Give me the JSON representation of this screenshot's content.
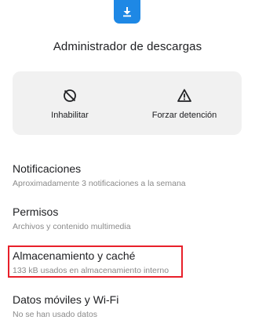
{
  "app": {
    "title": "Administrador de descargas",
    "icon": "download-icon",
    "icon_color": "#1e88e5"
  },
  "actions": [
    {
      "label": "Inhabilitar",
      "icon": "disable-icon"
    },
    {
      "label": "Forzar detención",
      "icon": "warning-icon"
    }
  ],
  "settings": [
    {
      "title": "Notificaciones",
      "subtitle": "Aproximadamente 3 notificaciones a la semana"
    },
    {
      "title": "Permisos",
      "subtitle": "Archivos y contenido multimedia"
    },
    {
      "title": "Almacenamiento y caché",
      "subtitle": "133 kB usados en almacenamiento interno",
      "highlighted": true
    },
    {
      "title": "Datos móviles y Wi-Fi",
      "subtitle": "No se han usado datos"
    }
  ],
  "colors": {
    "highlight": "#e8202a",
    "card_background": "#f1f1f1",
    "subtitle_text": "#8a8a8a"
  }
}
